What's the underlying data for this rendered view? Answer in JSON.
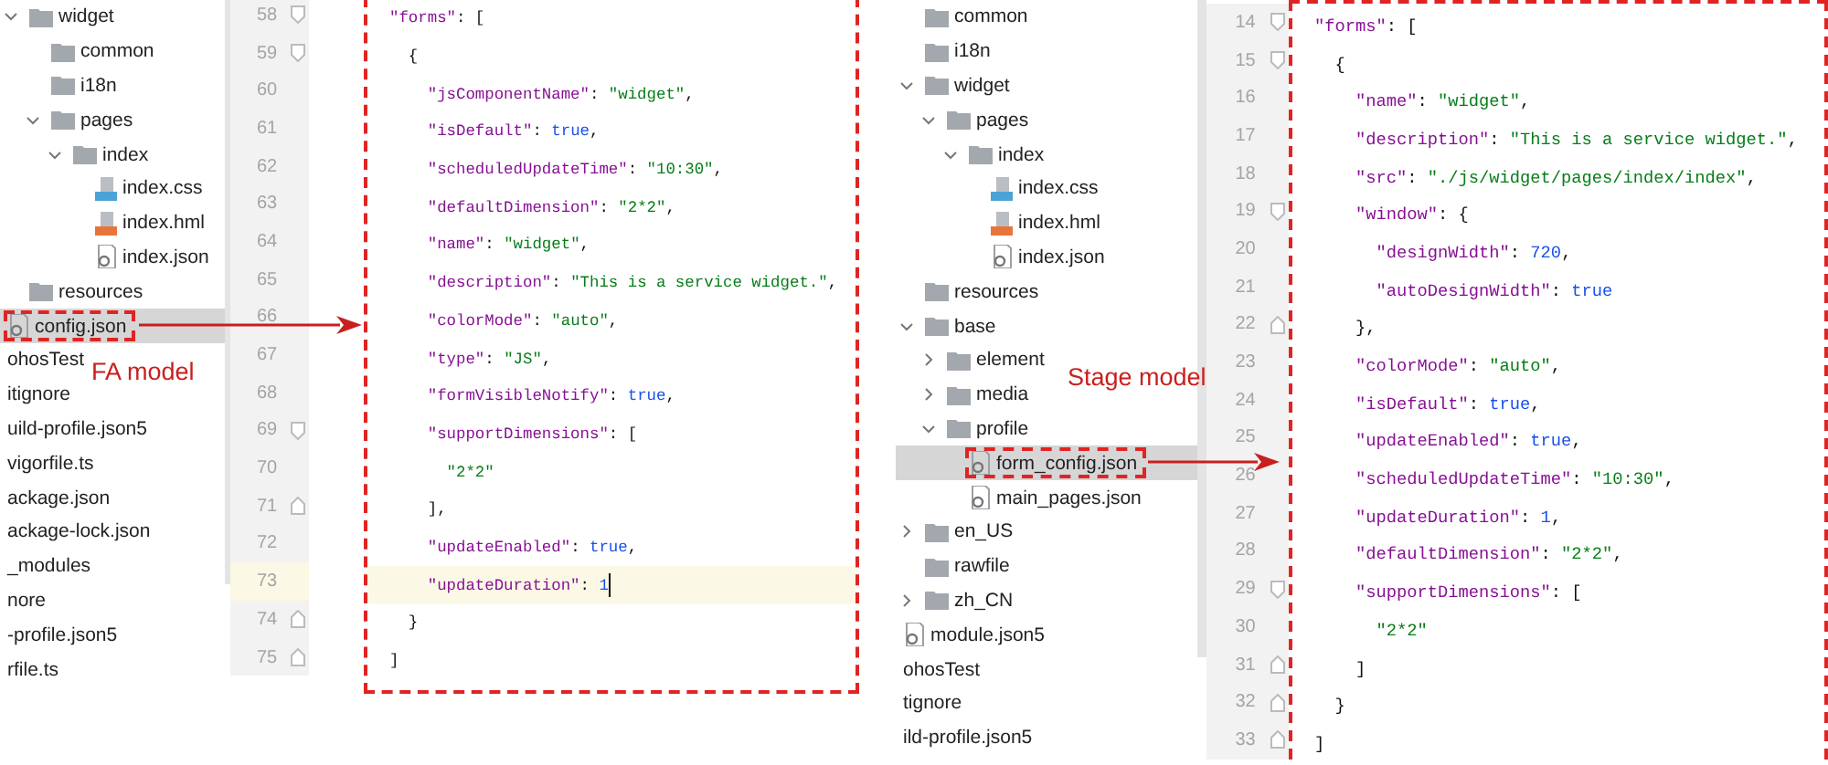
{
  "panels": [
    {
      "label": "FA model",
      "tree": [
        {
          "label": "widget",
          "kind": "folder",
          "selected": false,
          "expanded": true,
          "children": [
            {
              "label": "common",
              "kind": "folder",
              "selected": false
            },
            {
              "label": "i18n",
              "kind": "folder",
              "selected": false
            },
            {
              "label": "pages",
              "kind": "folder",
              "selected": false,
              "expanded": true,
              "children": [
                {
                  "label": "index",
                  "kind": "folder",
                  "selected": false,
                  "expanded": true,
                  "children": [
                    {
                      "label": "index.css",
                      "kind": "css",
                      "selected": false
                    },
                    {
                      "label": "index.hml",
                      "kind": "hml",
                      "selected": false
                    },
                    {
                      "label": "index.json",
                      "kind": "json",
                      "selected": false
                    }
                  ]
                }
              ]
            }
          ]
        },
        {
          "label": "resources",
          "kind": "folder",
          "selected": false
        },
        {
          "label": "config.json",
          "kind": "json",
          "selected": true
        },
        {
          "label": "ohosTest",
          "kind": "plain",
          "selected": false
        },
        {
          "label": "itignore",
          "kind": "plain",
          "selected": false
        },
        {
          "label": "uild-profile.json5",
          "kind": "plain",
          "selected": false
        },
        {
          "label": "vigorfile.ts",
          "kind": "plain",
          "selected": false
        },
        {
          "label": "ackage.json",
          "kind": "plain",
          "selected": false
        },
        {
          "label": "ackage-lock.json",
          "kind": "plain",
          "selected": false
        },
        {
          "label": "_modules",
          "kind": "plain",
          "selected": false
        },
        {
          "label": "nore",
          "kind": "plain",
          "selected": false
        },
        {
          "label": "-profile.json5",
          "kind": "plain",
          "selected": false
        },
        {
          "label": "rfile.ts",
          "kind": "plain",
          "selected": false
        }
      ],
      "lines": [
        {
          "number": "58",
          "fold_start": true,
          "current": false,
          "tokens": [
            {
              "kind": "key",
              "text": "\"forms\""
            },
            {
              "kind": "punct",
              "text": ": ["
            }
          ]
        },
        {
          "number": "59",
          "fold_start": true,
          "current": false,
          "tokens": [
            {
              "kind": "punct",
              "text": "  {"
            }
          ]
        },
        {
          "number": "60",
          "current": false,
          "tokens": [
            {
              "kind": "key",
              "text": "    \"jsComponentName\""
            },
            {
              "kind": "punct",
              "text": ": "
            },
            {
              "kind": "string",
              "text": "\"widget\""
            },
            {
              "kind": "punct",
              "text": ","
            }
          ]
        },
        {
          "number": "61",
          "current": false,
          "tokens": [
            {
              "kind": "key",
              "text": "    \"isDefault\""
            },
            {
              "kind": "punct",
              "text": ": "
            },
            {
              "kind": "literal",
              "text": "true"
            },
            {
              "kind": "punct",
              "text": ","
            }
          ]
        },
        {
          "number": "62",
          "current": false,
          "tokens": [
            {
              "kind": "key",
              "text": "    \"scheduledUpdateTime\""
            },
            {
              "kind": "punct",
              "text": ": "
            },
            {
              "kind": "string",
              "text": "\"10:30\""
            },
            {
              "kind": "punct",
              "text": ","
            }
          ]
        },
        {
          "number": "63",
          "current": false,
          "tokens": [
            {
              "kind": "key",
              "text": "    \"defaultDimension\""
            },
            {
              "kind": "punct",
              "text": ": "
            },
            {
              "kind": "string",
              "text": "\"2*2\""
            },
            {
              "kind": "punct",
              "text": ","
            }
          ]
        },
        {
          "number": "64",
          "current": false,
          "tokens": [
            {
              "kind": "key",
              "text": "    \"name\""
            },
            {
              "kind": "punct",
              "text": ": "
            },
            {
              "kind": "string",
              "text": "\"widget\""
            },
            {
              "kind": "punct",
              "text": ","
            }
          ]
        },
        {
          "number": "65",
          "current": false,
          "tokens": [
            {
              "kind": "key",
              "text": "    \"description\""
            },
            {
              "kind": "punct",
              "text": ": "
            },
            {
              "kind": "string",
              "text": "\"This is a service widget.\""
            },
            {
              "kind": "punct",
              "text": ","
            }
          ]
        },
        {
          "number": "66",
          "current": false,
          "tokens": [
            {
              "kind": "key",
              "text": "    \"colorMode\""
            },
            {
              "kind": "punct",
              "text": ": "
            },
            {
              "kind": "string",
              "text": "\"auto\""
            },
            {
              "kind": "punct",
              "text": ","
            }
          ]
        },
        {
          "number": "67",
          "current": false,
          "tokens": [
            {
              "kind": "key",
              "text": "    \"type\""
            },
            {
              "kind": "punct",
              "text": ": "
            },
            {
              "kind": "string",
              "text": "\"JS\""
            },
            {
              "kind": "punct",
              "text": ","
            }
          ]
        },
        {
          "number": "68",
          "current": false,
          "tokens": [
            {
              "kind": "key",
              "text": "    \"formVisibleNotify\""
            },
            {
              "kind": "punct",
              "text": ": "
            },
            {
              "kind": "literal",
              "text": "true"
            },
            {
              "kind": "punct",
              "text": ","
            }
          ]
        },
        {
          "number": "69",
          "fold_start": true,
          "current": false,
          "tokens": [
            {
              "kind": "key",
              "text": "    \"supportDimensions\""
            },
            {
              "kind": "punct",
              "text": ": ["
            }
          ]
        },
        {
          "number": "70",
          "current": false,
          "tokens": [
            {
              "kind": "string",
              "text": "      \"2*2\""
            }
          ]
        },
        {
          "number": "71",
          "fold_end": true,
          "current": false,
          "tokens": [
            {
              "kind": "punct",
              "text": "    ],"
            }
          ]
        },
        {
          "number": "72",
          "current": false,
          "tokens": [
            {
              "kind": "key",
              "text": "    \"updateEnabled\""
            },
            {
              "kind": "punct",
              "text": ": "
            },
            {
              "kind": "literal",
              "text": "true"
            },
            {
              "kind": "punct",
              "text": ","
            }
          ]
        },
        {
          "number": "73",
          "current": true,
          "tokens": [
            {
              "kind": "key",
              "text": "    \"updateDuration\""
            },
            {
              "kind": "punct",
              "text": ": "
            },
            {
              "kind": "literal",
              "text": "1"
            }
          ]
        },
        {
          "number": "74",
          "fold_end": true,
          "current": false,
          "tokens": [
            {
              "kind": "punct",
              "text": "  }"
            }
          ]
        },
        {
          "number": "75",
          "fold_end": true,
          "current": false,
          "tokens": [
            {
              "kind": "punct",
              "text": "]"
            }
          ]
        }
      ]
    },
    {
      "label": "Stage model",
      "tree": [
        {
          "label": "common",
          "kind": "folder",
          "selected": false
        },
        {
          "label": "i18n",
          "kind": "folder",
          "selected": false
        },
        {
          "label": "widget",
          "kind": "folder",
          "selected": false,
          "expanded": true,
          "children": [
            {
              "label": "pages",
              "kind": "folder",
              "selected": false,
              "expanded": true,
              "children": [
                {
                  "label": "index",
                  "kind": "folder",
                  "selected": false,
                  "expanded": true,
                  "children": [
                    {
                      "label": "index.css",
                      "kind": "css",
                      "selected": false
                    },
                    {
                      "label": "index.hml",
                      "kind": "hml",
                      "selected": false
                    },
                    {
                      "label": "index.json",
                      "kind": "json",
                      "selected": false
                    }
                  ]
                }
              ]
            }
          ]
        },
        {
          "label": "resources",
          "kind": "folder",
          "selected": false
        },
        {
          "label": "base",
          "kind": "folder",
          "selected": false,
          "expanded": true,
          "children": [
            {
              "label": "element",
              "kind": "folder",
              "selected": false,
              "expanded": false
            },
            {
              "label": "media",
              "kind": "folder",
              "selected": false,
              "expanded": false
            },
            {
              "label": "profile",
              "kind": "folder",
              "selected": false,
              "expanded": true,
              "children": [
                {
                  "label": "form_config.json",
                  "kind": "json",
                  "selected": true
                },
                {
                  "label": "main_pages.json",
                  "kind": "json",
                  "selected": false
                }
              ]
            }
          ]
        },
        {
          "label": "en_US",
          "kind": "folder",
          "selected": false,
          "expanded": false
        },
        {
          "label": "rawfile",
          "kind": "folder",
          "selected": false
        },
        {
          "label": "zh_CN",
          "kind": "folder",
          "selected": false,
          "expanded": false
        },
        {
          "label": "module.json5",
          "kind": "json",
          "selected": false
        },
        {
          "label": "ohosTest",
          "kind": "plain",
          "selected": false
        },
        {
          "label": "tignore",
          "kind": "plain",
          "selected": false
        },
        {
          "label": "ild-profile.json5",
          "kind": "plain",
          "selected": false
        }
      ],
      "lines": [
        {
          "number": "14",
          "fold_start": true,
          "current": false,
          "tokens": [
            {
              "kind": "key",
              "text": "\"forms\""
            },
            {
              "kind": "punct",
              "text": ": ["
            }
          ]
        },
        {
          "number": "15",
          "fold_start": true,
          "current": false,
          "tokens": [
            {
              "kind": "punct",
              "text": "  {"
            }
          ]
        },
        {
          "number": "16",
          "current": false,
          "tokens": [
            {
              "kind": "key",
              "text": "    \"name\""
            },
            {
              "kind": "punct",
              "text": ": "
            },
            {
              "kind": "string",
              "text": "\"widget\""
            },
            {
              "kind": "punct",
              "text": ","
            }
          ]
        },
        {
          "number": "17",
          "current": false,
          "tokens": [
            {
              "kind": "key",
              "text": "    \"description\""
            },
            {
              "kind": "punct",
              "text": ": "
            },
            {
              "kind": "string",
              "text": "\"This is a service widget.\""
            },
            {
              "kind": "punct",
              "text": ","
            }
          ]
        },
        {
          "number": "18",
          "current": false,
          "tokens": [
            {
              "kind": "key",
              "text": "    \"src\""
            },
            {
              "kind": "punct",
              "text": ": "
            },
            {
              "kind": "string",
              "text": "\"./js/widget/pages/index/index\""
            },
            {
              "kind": "punct",
              "text": ","
            }
          ]
        },
        {
          "number": "19",
          "fold_start": true,
          "current": false,
          "tokens": [
            {
              "kind": "key",
              "text": "    \"window\""
            },
            {
              "kind": "punct",
              "text": ": {"
            }
          ]
        },
        {
          "number": "20",
          "current": false,
          "tokens": [
            {
              "kind": "key",
              "text": "      \"designWidth\""
            },
            {
              "kind": "punct",
              "text": ": "
            },
            {
              "kind": "literal",
              "text": "720"
            },
            {
              "kind": "punct",
              "text": ","
            }
          ]
        },
        {
          "number": "21",
          "current": false,
          "tokens": [
            {
              "kind": "key",
              "text": "      \"autoDesignWidth\""
            },
            {
              "kind": "punct",
              "text": ": "
            },
            {
              "kind": "literal",
              "text": "true"
            }
          ]
        },
        {
          "number": "22",
          "fold_end": true,
          "current": false,
          "tokens": [
            {
              "kind": "punct",
              "text": "    },"
            }
          ]
        },
        {
          "number": "23",
          "current": false,
          "tokens": [
            {
              "kind": "key",
              "text": "    \"colorMode\""
            },
            {
              "kind": "punct",
              "text": ": "
            },
            {
              "kind": "string",
              "text": "\"auto\""
            },
            {
              "kind": "punct",
              "text": ","
            }
          ]
        },
        {
          "number": "24",
          "current": false,
          "tokens": [
            {
              "kind": "key",
              "text": "    \"isDefault\""
            },
            {
              "kind": "punct",
              "text": ": "
            },
            {
              "kind": "literal",
              "text": "true"
            },
            {
              "kind": "punct",
              "text": ","
            }
          ]
        },
        {
          "number": "25",
          "current": false,
          "tokens": [
            {
              "kind": "key",
              "text": "    \"updateEnabled\""
            },
            {
              "kind": "punct",
              "text": ": "
            },
            {
              "kind": "literal",
              "text": "true"
            },
            {
              "kind": "punct",
              "text": ","
            }
          ]
        },
        {
          "number": "26",
          "current": false,
          "tokens": [
            {
              "kind": "key",
              "text": "    \"scheduledUpdateTime\""
            },
            {
              "kind": "punct",
              "text": ": "
            },
            {
              "kind": "string",
              "text": "\"10:30\""
            },
            {
              "kind": "punct",
              "text": ","
            }
          ]
        },
        {
          "number": "27",
          "current": false,
          "tokens": [
            {
              "kind": "key",
              "text": "    \"updateDuration\""
            },
            {
              "kind": "punct",
              "text": ": "
            },
            {
              "kind": "literal",
              "text": "1"
            },
            {
              "kind": "punct",
              "text": ","
            }
          ]
        },
        {
          "number": "28",
          "current": false,
          "tokens": [
            {
              "kind": "key",
              "text": "    \"defaultDimension\""
            },
            {
              "kind": "punct",
              "text": ": "
            },
            {
              "kind": "string",
              "text": "\"2*2\""
            },
            {
              "kind": "punct",
              "text": ","
            }
          ]
        },
        {
          "number": "29",
          "fold_start": true,
          "current": false,
          "tokens": [
            {
              "kind": "key",
              "text": "    \"supportDimensions\""
            },
            {
              "kind": "punct",
              "text": ": ["
            }
          ]
        },
        {
          "number": "30",
          "current": false,
          "tokens": [
            {
              "kind": "string",
              "text": "      \"2*2\""
            }
          ]
        },
        {
          "number": "31",
          "fold_end": true,
          "current": false,
          "tokens": [
            {
              "kind": "punct",
              "text": "    ]"
            }
          ]
        },
        {
          "number": "32",
          "fold_end": true,
          "current": false,
          "tokens": [
            {
              "kind": "punct",
              "text": "  }"
            }
          ]
        },
        {
          "number": "33",
          "fold_end": true,
          "current": false,
          "tokens": [
            {
              "kind": "punct",
              "text": "]"
            }
          ]
        }
      ]
    }
  ]
}
